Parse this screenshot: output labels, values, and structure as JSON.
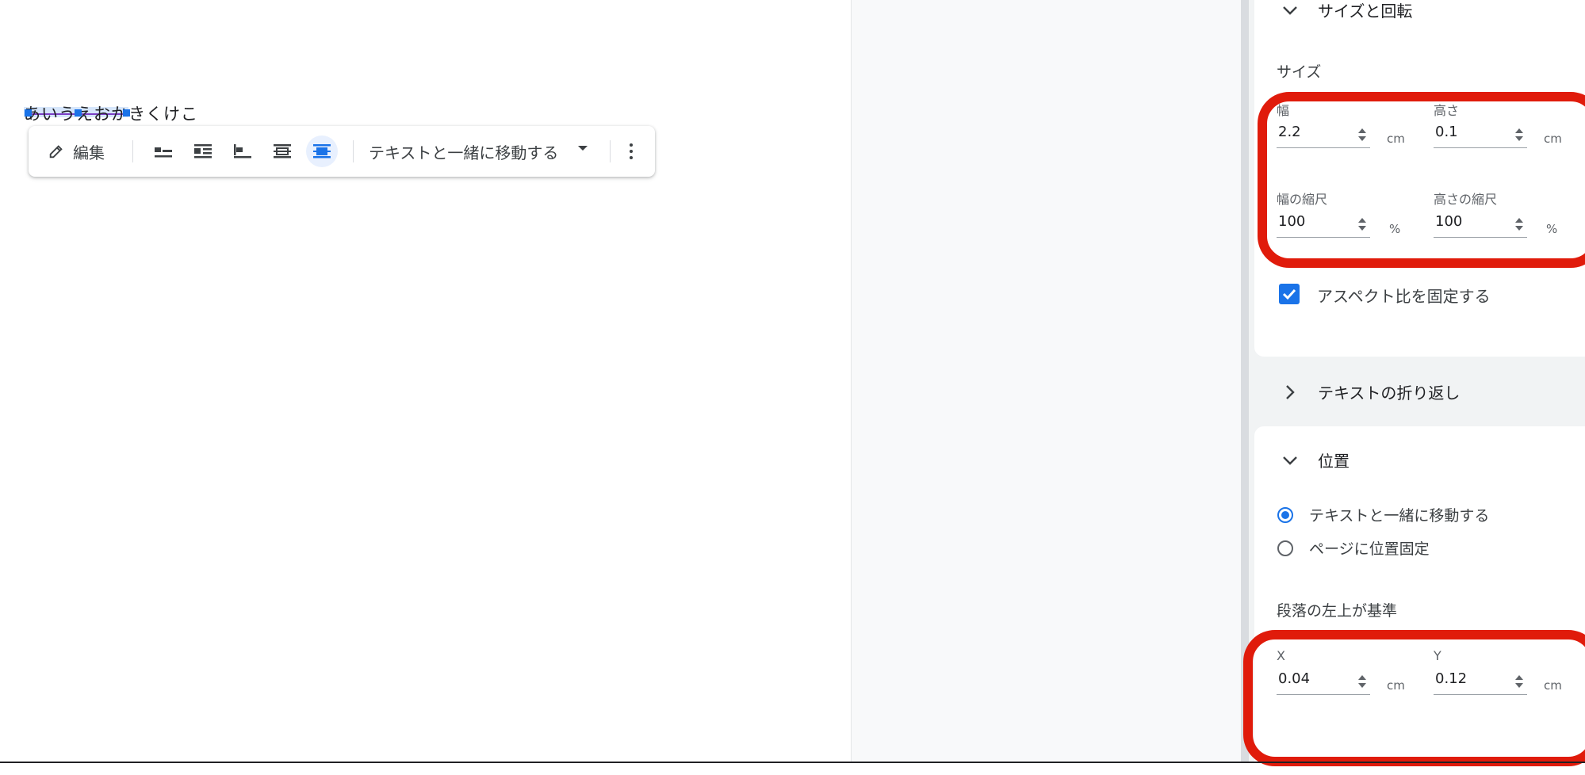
{
  "document": {
    "text": "あいうえおかきくけこ"
  },
  "image_toolbar": {
    "edit_label": "編集",
    "wrap_options": [
      {
        "icon": "inline-wrap-icon"
      },
      {
        "icon": "wrap-text-icon"
      },
      {
        "icon": "break-text-icon"
      },
      {
        "icon": "behind-text-icon"
      },
      {
        "icon": "in-front-of-text-icon"
      }
    ],
    "position_mode": "テキストと一緒に移動する"
  },
  "size_section": {
    "title": "サイズと回転",
    "subheading": "サイズ",
    "width_label": "幅",
    "width_value": "2.2",
    "width_unit": "cm",
    "height_label": "高さ",
    "height_value": "0.1",
    "height_unit": "cm",
    "width_scale_label": "幅の縮尺",
    "width_scale_value": "100",
    "width_scale_unit": "%",
    "height_scale_label": "高さの縮尺",
    "height_scale_value": "100",
    "height_scale_unit": "%",
    "lock_aspect_label": "アスペクト比を固定する",
    "lock_aspect_checked": true
  },
  "wrap_section": {
    "title": "テキストの折り返し"
  },
  "position_section": {
    "title": "位置",
    "options": [
      {
        "label": "テキストと一緒に移動する",
        "selected": true
      },
      {
        "label": "ページに位置固定",
        "selected": false
      }
    ],
    "reference_label": "段落の左上が基準",
    "x_label": "X",
    "x_value": "0.04",
    "x_unit": "cm",
    "y_label": "Y",
    "y_value": "0.12",
    "y_unit": "cm"
  },
  "colors": {
    "accent": "#1a73e8",
    "highlight": "#e01b0b"
  }
}
